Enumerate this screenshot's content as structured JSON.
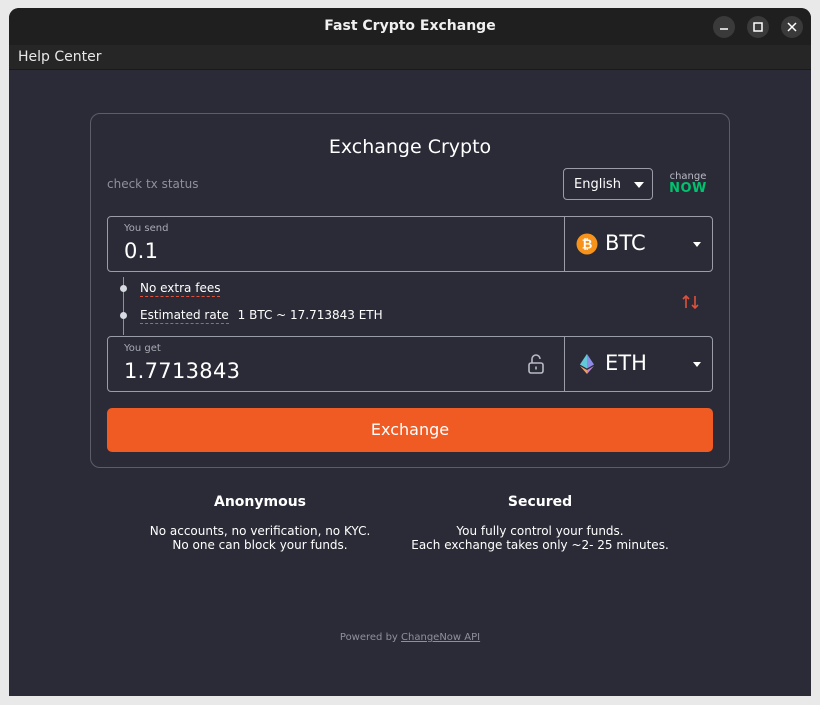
{
  "window": {
    "title": "Fast Crypto Exchange"
  },
  "menu": {
    "help_center": "Help Center"
  },
  "card": {
    "title": "Exchange Crypto",
    "check_status": "check tx status",
    "language": "English",
    "logo_top": "change",
    "logo_bottom": "NOW",
    "send": {
      "label": "You send",
      "value": "0.1",
      "currency": "BTC",
      "icon": "bitcoin-icon",
      "icon_color": "#f7931a"
    },
    "no_fees": "No extra fees",
    "estimated_rate_label": "Estimated rate",
    "estimated_rate_value": "1 BTC ~ 17.713843 ETH",
    "get": {
      "label": "You get",
      "value": "1.7713843",
      "currency": "ETH",
      "icon": "ethereum-icon"
    },
    "exchange_button": "Exchange"
  },
  "features": [
    {
      "title": "Anonymous",
      "line1": "No accounts, no verification, no KYC.",
      "line2": "No one can block your funds."
    },
    {
      "title": "Secured",
      "line1": "You fully control your funds.",
      "line2": "Each exchange takes only ~2- 25 minutes."
    }
  ],
  "footer": {
    "prefix": "Powered by ",
    "link": "ChangeNow API"
  },
  "colors": {
    "accent": "#f05b24",
    "background": "#2a2b36",
    "brand_green": "#00c26f",
    "swap_icon": "#e0513c"
  }
}
